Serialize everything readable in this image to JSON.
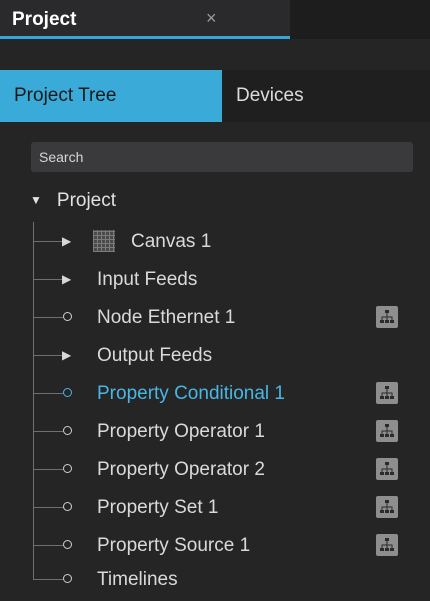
{
  "panel": {
    "title": "Project",
    "close_glyph": "×"
  },
  "tabs": [
    {
      "label": "Project Tree",
      "active": true
    },
    {
      "label": "Devices",
      "active": false
    }
  ],
  "search": {
    "placeholder": "Search"
  },
  "tree": {
    "root": {
      "label": "Project",
      "caret": "▼"
    },
    "items": [
      {
        "label": "Canvas 1",
        "kind": "expandable",
        "icon": "canvas-grid-icon"
      },
      {
        "label": "Input Feeds",
        "kind": "expandable"
      },
      {
        "label": "Node Ethernet 1",
        "kind": "leaf",
        "badge_icon": "network-tree-icon"
      },
      {
        "label": "Output Feeds",
        "kind": "expandable"
      },
      {
        "label": "Property Conditional 1",
        "kind": "leaf",
        "badge_icon": "network-tree-icon",
        "selected": true
      },
      {
        "label": "Property Operator 1",
        "kind": "leaf",
        "badge_icon": "network-tree-icon"
      },
      {
        "label": "Property Operator 2",
        "kind": "leaf",
        "badge_icon": "network-tree-icon"
      },
      {
        "label": "Property Set 1",
        "kind": "leaf",
        "badge_icon": "network-tree-icon"
      },
      {
        "label": "Property Source 1",
        "kind": "leaf",
        "badge_icon": "network-tree-icon"
      },
      {
        "label": "Timelines",
        "kind": "leaf"
      }
    ]
  },
  "colors": {
    "accent": "#3aaad8",
    "selected_text": "#49b6e4",
    "background": "#252526"
  },
  "glyphs": {
    "expand_arrow": "▶"
  }
}
